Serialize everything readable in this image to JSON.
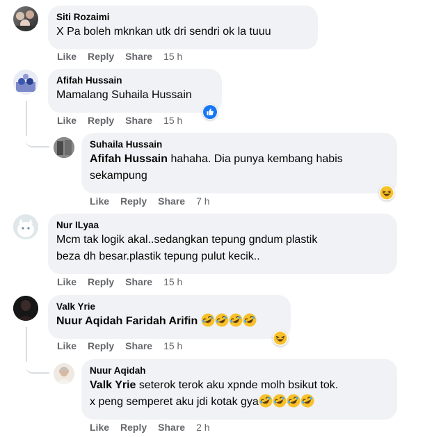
{
  "comments": [
    {
      "name": "Siti Rozaimi",
      "text": "X Pa boleh mknkan utk dri sendri ok la tuuu",
      "like": "Like",
      "reply": "Reply",
      "share": "Share",
      "time": "15 h"
    },
    {
      "name": "Afifah Hussain",
      "text": "Mamalang Suhaila Hussain",
      "like": "Like",
      "reply": "Reply",
      "share": "Share",
      "time": "15 h",
      "reaction": "like-reaction-icon"
    },
    {
      "name": "Suhaila Hussain",
      "mention": "Afifah Hussain",
      "text_line1": " hahaha. Dia punya kembang habis",
      "text_line2": "sekampung",
      "like": "Like",
      "reply": "Reply",
      "share": "Share",
      "time": "7 h",
      "reaction": "haha-reaction-icon"
    },
    {
      "name": "Nur ILyaa",
      "text_line1": "Mcm tak logik akal..sedangkan tepung gndum plastik",
      "text_line2": "beza dh besar.plastik tepung pulut kecik..",
      "like": "Like",
      "reply": "Reply",
      "share": "Share",
      "time": "15 h"
    },
    {
      "name": "Valk Yrie",
      "mention": "Nuur Aqidah Faridah Arifin",
      "like": "Like",
      "reply": "Reply",
      "share": "Share",
      "time": "15 h",
      "reaction": "haha-reaction-icon"
    },
    {
      "name": "Nuur Aqidah",
      "mention": "Valk Yrie",
      "text_line1": " seterok terok aku xpnde molh bsikut tok.",
      "text_line2": "x peng semperet aku jdi kotak gya",
      "like": "Like",
      "reply": "Reply",
      "share": "Share",
      "time": "2 h"
    }
  ],
  "colors": {
    "bubble": "#f0f2f5",
    "meta": "#65676b",
    "like_blue": "#1877f2",
    "haha_yellow": "#f7b928"
  }
}
